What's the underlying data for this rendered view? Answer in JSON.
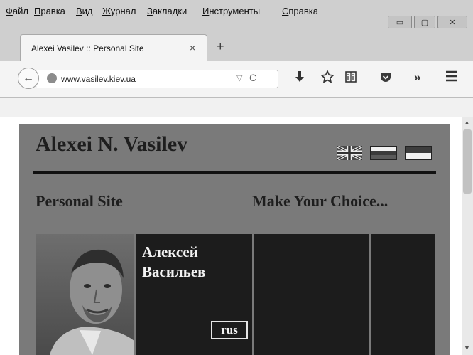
{
  "menubar": {
    "items": [
      {
        "pre": "",
        "ul": "Ф",
        "rest": "айл"
      },
      {
        "pre": "",
        "ul": "П",
        "rest": "равка"
      },
      {
        "pre": "",
        "ul": "В",
        "rest": "ид"
      },
      {
        "pre": "",
        "ul": "Ж",
        "rest": "урнал"
      },
      {
        "pre": "",
        "ul": "З",
        "rest": "акладки"
      },
      {
        "pre": "",
        "ul": "И",
        "rest": "нструменты"
      },
      {
        "pre": "",
        "ul": "С",
        "rest": "правка"
      }
    ]
  },
  "window_controls": {
    "minimize": "▭",
    "maximize": "▢",
    "close": "✕"
  },
  "tab": {
    "title": "Alexei Vasilev :: Personal Site",
    "close": "×",
    "new_tab": "+"
  },
  "navbar": {
    "back": "←",
    "url": "www.vasilev.kiev.ua",
    "dropdown": "▽",
    "reload": "C",
    "icons": [
      "download-icon",
      "star-icon",
      "reading-list-icon",
      "pocket-icon",
      "overflow-icon",
      "hamburger-menu-icon"
    ]
  },
  "site": {
    "title": "Alexei N. Vasilev",
    "subtitle": "Personal Site",
    "choice": "Make Your Choice...",
    "name_line1": "Алексей",
    "name_line2": "Васильев",
    "lang_button": "rus"
  },
  "colors": {
    "site_bg": "#7a7a7a",
    "panel_bg": "#1c1c1c",
    "heading": "#1e1e1e",
    "panel_text": "#f2f2f2"
  }
}
